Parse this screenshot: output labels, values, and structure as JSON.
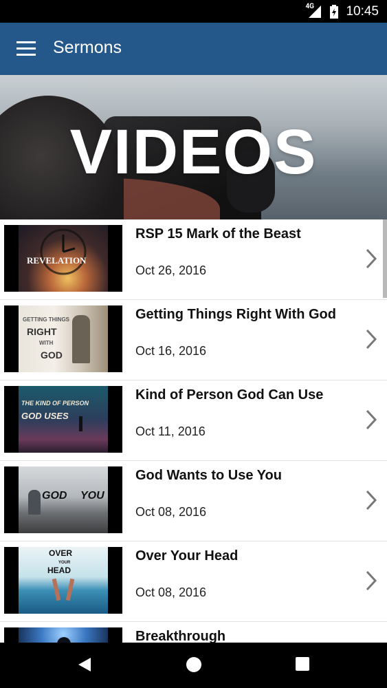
{
  "status_bar": {
    "network": "4G",
    "time": "10:45"
  },
  "app_bar": {
    "title": "Sermons",
    "menu_icon": "hamburger-icon"
  },
  "hero": {
    "title": "VIDEOS"
  },
  "sermons": [
    {
      "title": "RSP 15 Mark of the Beast",
      "date": "Oct 26, 2016",
      "thumb_text": [
        "REVELATION"
      ]
    },
    {
      "title": "Getting Things Right With God",
      "date": "Oct 16, 2016",
      "thumb_text": [
        "GETTING THINGS",
        "RIGHT",
        "WITH",
        "GOD"
      ]
    },
    {
      "title": "Kind of Person God Can Use",
      "date": "Oct 11, 2016",
      "thumb_text": [
        "THE KIND OF PERSON",
        "GOD USES"
      ]
    },
    {
      "title": "God Wants to Use You",
      "date": "Oct 08, 2016",
      "thumb_text": [
        "GOD",
        "YOU"
      ]
    },
    {
      "title": "Over Your Head",
      "date": "Oct 08, 2016",
      "thumb_text": [
        "OVER",
        "YOUR",
        "HEAD"
      ]
    },
    {
      "title": "Breakthrough",
      "date": ""
    }
  ],
  "nav_bar": {
    "back_icon": "back-icon",
    "home_icon": "home-icon",
    "recents_icon": "recents-icon"
  }
}
